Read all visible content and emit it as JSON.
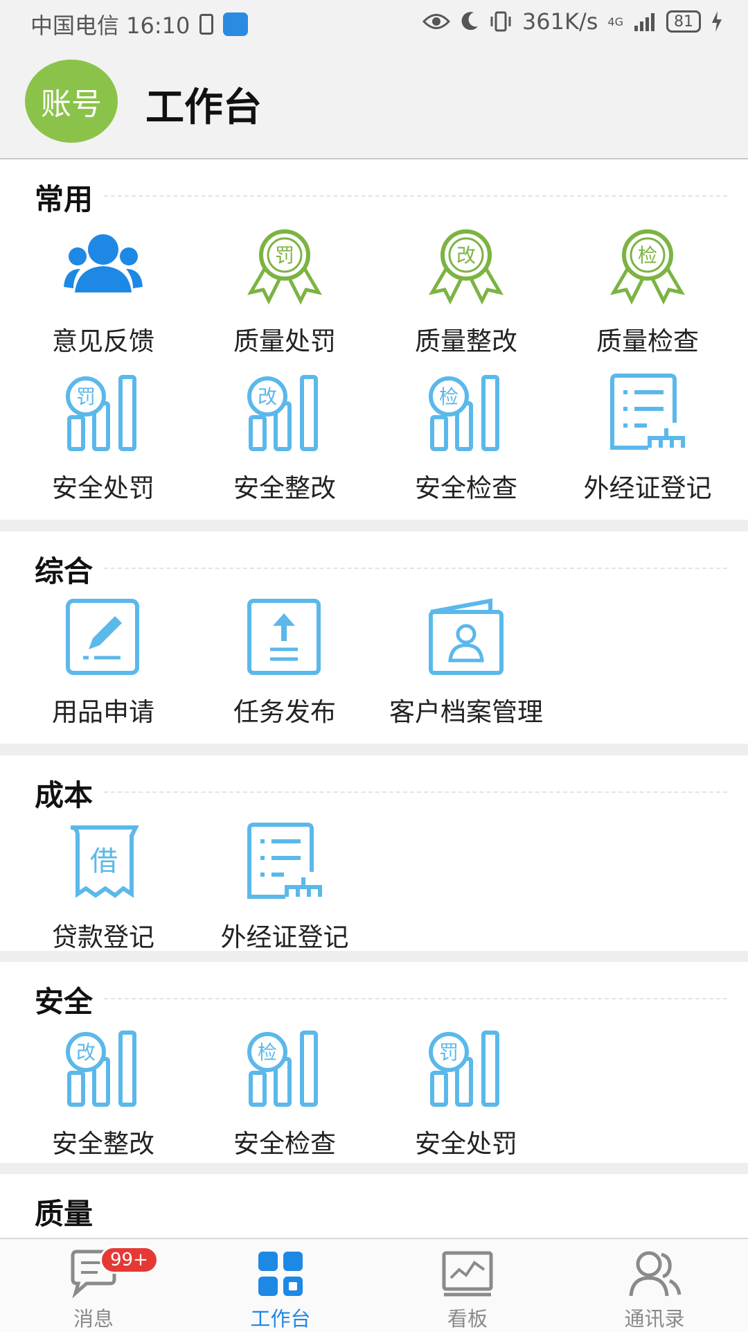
{
  "status_bar": {
    "carrier_time": "中国电信 16:10",
    "net_speed": "361K/s",
    "network": "4G",
    "battery": "81"
  },
  "header": {
    "avatar_text": "账号",
    "title": "工作台"
  },
  "sections": {
    "common": {
      "title": "常用",
      "items": [
        "意见反馈",
        "质量处罚",
        "质量整改",
        "质量检查",
        "安全处罚",
        "安全整改",
        "安全检查",
        "外经证登记"
      ]
    },
    "general": {
      "title": "综合",
      "items": [
        "用品申请",
        "任务发布",
        "客户档案管理"
      ]
    },
    "cost": {
      "title": "成本",
      "items": [
        "贷款登记",
        "外经证登记"
      ]
    },
    "safety": {
      "title": "安全",
      "items": [
        "安全整改",
        "安全检查",
        "安全处罚"
      ]
    },
    "quality": {
      "title": "质量"
    }
  },
  "icon_glyphs": {
    "fine": "罚",
    "rectify": "改",
    "inspect": "检",
    "loan": "借"
  },
  "tabbar": {
    "tabs": [
      "消息",
      "工作台",
      "看板",
      "通讯录"
    ],
    "badge": "99+",
    "active": "工作台"
  },
  "colors": {
    "accent_blue": "#1e88e5",
    "light_blue": "#5bb8ea",
    "green": "#8bc34a",
    "badge_red": "#e53935"
  }
}
